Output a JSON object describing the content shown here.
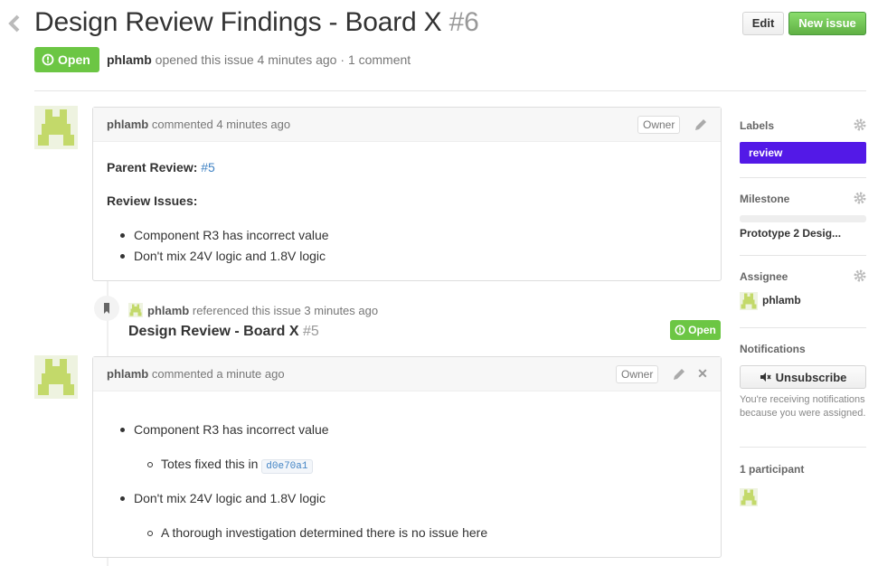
{
  "issue": {
    "title": "Design Review Findings - Board X",
    "number": "#6",
    "status": "Open",
    "author": "phlamb",
    "meta_text": "opened this issue 4 minutes ago",
    "comment_count": "1 comment"
  },
  "toolbar": {
    "edit_label": "Edit",
    "new_issue_label": "New issue"
  },
  "comments": [
    {
      "author": "phlamb",
      "action": "commented 4 minutes ago",
      "owner_badge": "Owner",
      "parent_review_label": "Parent Review:",
      "parent_review_link": "#5",
      "review_issues_label": "Review Issues:",
      "items": [
        "Component R3 has incorrect value",
        "Don't mix 24V logic and 1.8V logic"
      ]
    },
    {
      "author": "phlamb",
      "action": "commented a minute ago",
      "owner_badge": "Owner",
      "item1": "Component R3 has incorrect value",
      "item1_sub": "Totes fixed this in",
      "item1_sha": "d0e70a1",
      "item2": "Don't mix 24V logic and 1.8V logic",
      "item2_sub": "A thorough investigation determined there is no issue here"
    }
  ],
  "reference": {
    "author": "phlamb",
    "action": "referenced this issue 3 minutes ago",
    "title": "Design Review - Board X",
    "number": "#5",
    "status": "Open"
  },
  "sidebar": {
    "labels_heading": "Labels",
    "label": "review",
    "milestone_heading": "Milestone",
    "milestone_name": "Prototype 2 Desig...",
    "milestone_progress": 0,
    "assignee_heading": "Assignee",
    "assignee_name": "phlamb",
    "notifications_heading": "Notifications",
    "unsubscribe_label": "Unsubscribe",
    "notifications_text": "You're receiving notifications because you were assigned.",
    "participants_heading": "1 participant"
  },
  "colors": {
    "open_green": "#6cc644",
    "label_review": "#5319e7",
    "link": "#4183c4",
    "avatar_green": "#c3d96a"
  }
}
